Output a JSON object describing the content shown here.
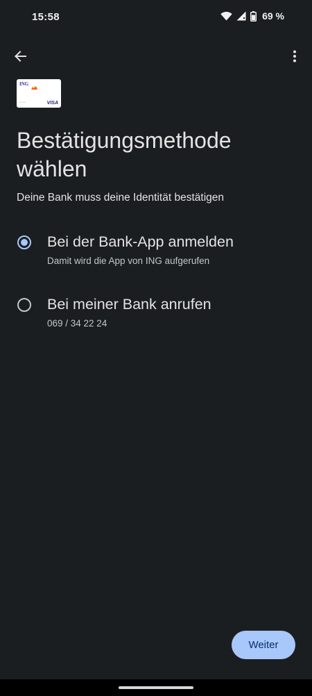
{
  "status_bar": {
    "time": "15:58",
    "battery": "69 %",
    "icons": [
      "wifi-icon",
      "signal-icon",
      "battery-icon"
    ]
  },
  "app_bar": {
    "back_icon": "arrow-back-icon",
    "more_icon": "more-vert-icon"
  },
  "card": {
    "bank": "ING",
    "network": "VISA"
  },
  "title": "Bestätigungsmethode wählen",
  "subtitle": "Deine Bank muss deine Identität bestätigen",
  "options": [
    {
      "label": "Bei der Bank-App anmelden",
      "description": "Damit wird die App von ING aufgerufen",
      "selected": true
    },
    {
      "label": "Bei meiner Bank anrufen",
      "description": "069 / 34 22 24",
      "selected": false
    }
  ],
  "continue_label": "Weiter",
  "colors": {
    "background": "#1b1e21",
    "accent": "#a8c7fa",
    "on_accent": "#062e6f",
    "text_primary": "#e3e3e3",
    "text_secondary": "#c4c7c5"
  }
}
